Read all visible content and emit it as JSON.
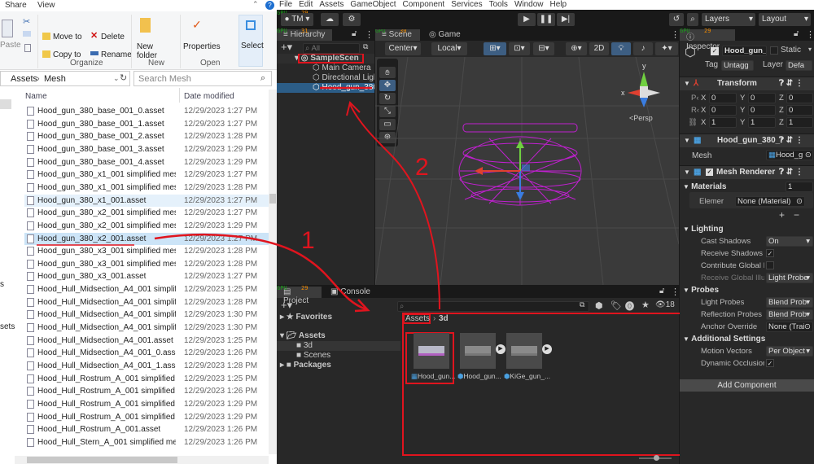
{
  "explorer": {
    "ribbon_tabs": [
      "Share",
      "View"
    ],
    "clipboard": {
      "paste": "Paste"
    },
    "organize": {
      "move_to": "Move to",
      "copy_to": "Copy to",
      "delete": "Delete",
      "rename": "Rename",
      "group": "Organize"
    },
    "new": {
      "new_folder": "New folder",
      "group": "New"
    },
    "open": {
      "properties": "Properties",
      "group": "Open"
    },
    "select": {
      "label": "Select"
    },
    "breadcrumb": [
      "Assets",
      "Mesh"
    ],
    "search_placeholder": "Search Mesh",
    "nav_labels": [
      "s",
      "sets"
    ],
    "columns": {
      "name": "Name",
      "date": "Date modified"
    },
    "files": [
      {
        "name": "Hood_gun_380_base_001_0.asset",
        "date": "12/29/2023 1:27 PM"
      },
      {
        "name": "Hood_gun_380_base_001_1.asset",
        "date": "12/29/2023 1:27 PM"
      },
      {
        "name": "Hood_gun_380_base_001_2.asset",
        "date": "12/29/2023 1:28 PM"
      },
      {
        "name": "Hood_gun_380_base_001_3.asset",
        "date": "12/29/2023 1:29 PM"
      },
      {
        "name": "Hood_gun_380_base_001_4.asset",
        "date": "12/29/2023 1:29 PM"
      },
      {
        "name": "Hood_gun_380_x1_001 simplified mesh.a...",
        "date": "12/29/2023 1:27 PM"
      },
      {
        "name": "Hood_gun_380_x1_001 simplified mesh_...",
        "date": "12/29/2023 1:28 PM"
      },
      {
        "name": "Hood_gun_380_x1_001.asset",
        "date": "12/29/2023 1:27 PM",
        "state": "hover"
      },
      {
        "name": "Hood_gun_380_x2_001 simplified mesh.a...",
        "date": "12/29/2023 1:27 PM"
      },
      {
        "name": "Hood_gun_380_x2_001 simplified mesh_...",
        "date": "12/29/2023 1:29 PM"
      },
      {
        "name": "Hood_gun_380_x2_001.asset",
        "date": "12/29/2023 1:27 PM",
        "state": "selected"
      },
      {
        "name": "Hood_gun_380_x3_001 simplified mesh.a...",
        "date": "12/29/2023 1:28 PM"
      },
      {
        "name": "Hood_gun_380_x3_001 simplified mesh_...",
        "date": "12/29/2023 1:28 PM"
      },
      {
        "name": "Hood_gun_380_x3_001.asset",
        "date": "12/29/2023 1:27 PM"
      },
      {
        "name": "Hood_Hull_Midsection_A4_001 simplified...",
        "date": "12/29/2023 1:25 PM"
      },
      {
        "name": "Hood_Hull_Midsection_A4_001 simplified...",
        "date": "12/29/2023 1:28 PM"
      },
      {
        "name": "Hood_Hull_Midsection_A4_001 simplified...",
        "date": "12/29/2023 1:30 PM"
      },
      {
        "name": "Hood_Hull_Midsection_A4_001 simplified...",
        "date": "12/29/2023 1:30 PM"
      },
      {
        "name": "Hood_Hull_Midsection_A4_001.asset",
        "date": "12/29/2023 1:25 PM"
      },
      {
        "name": "Hood_Hull_Midsection_A4_001_0.asset",
        "date": "12/29/2023 1:26 PM"
      },
      {
        "name": "Hood_Hull_Midsection_A4_001_1.asset",
        "date": "12/29/2023 1:28 PM"
      },
      {
        "name": "Hood_Hull_Rostrum_A_001 simplified me...",
        "date": "12/29/2023 1:25 PM"
      },
      {
        "name": "Hood_Hull_Rostrum_A_001 simplified me...",
        "date": "12/29/2023 1:26 PM"
      },
      {
        "name": "Hood_Hull_Rostrum_A_001 simplified me...",
        "date": "12/29/2023 1:29 PM"
      },
      {
        "name": "Hood_Hull_Rostrum_A_001 simplified me...",
        "date": "12/29/2023 1:29 PM"
      },
      {
        "name": "Hood_Hull_Rostrum_A_001.asset",
        "date": "12/29/2023 1:26 PM"
      },
      {
        "name": "Hood_Hull_Stern_A_001 simplified mesh....",
        "date": "12/29/2023 1:26 PM"
      }
    ]
  },
  "unity": {
    "menu": [
      "File",
      "Edit",
      "Assets",
      "GameObject",
      "Component",
      "Services",
      "Tools",
      "Window",
      "Help"
    ],
    "account": "TM",
    "layers": "Layers",
    "layout": "Layout",
    "overlay": {
      "gpu": "GPU",
      "temps": [
        "29",
        "31",
        "30",
        "29"
      ]
    },
    "hierarchy": {
      "title": "Hierarchy",
      "search_placeholder": "All",
      "scene": "SampleScen",
      "items": [
        "Main Camera",
        "Directional Ligl",
        "Hood_gun_380"
      ]
    },
    "scene": {
      "tabs": [
        "Scene",
        "Game"
      ],
      "pivot": "Center",
      "space": "Local",
      "mode_2d": "2D",
      "persp": "<Persp",
      "axis_x": "x",
      "axis_y": "y"
    },
    "project": {
      "tabs": [
        "Project",
        "Console"
      ],
      "tree": {
        "favorites": "Favorites",
        "assets": "Assets",
        "folders": [
          "3d",
          "Scenes"
        ],
        "packages": "Packages"
      },
      "breadcrumb": [
        "Assets",
        "3d"
      ],
      "hidden_count": "18",
      "items": [
        "Hood_gun...",
        "Hood_gun...",
        "KiGe_gun_..."
      ]
    },
    "inspector": {
      "title": "Inspector",
      "name": "Hood_gun_3",
      "static": "Static",
      "tag_label": "Tag",
      "tag": "Untagg",
      "layer_label": "Layer",
      "layer": "Defa",
      "transform": {
        "title": "Transform",
        "rows": [
          {
            "label": "P‹",
            "x": "0",
            "y": "0",
            "z": "0"
          },
          {
            "label": "R‹",
            "x": "0",
            "y": "0",
            "z": "0"
          },
          {
            "label": "",
            "x": "1",
            "y": "1",
            "z": "1"
          }
        ]
      },
      "mesh_filter": {
        "title": "Hood_gun_380_:",
        "mesh_label": "Mesh",
        "mesh": "Hood_g"
      },
      "mesh_renderer": {
        "title": "Mesh Renderer",
        "materials": "Materials",
        "materials_count": "1",
        "element": "Elemer",
        "element_value": "None (Material)",
        "lighting": "Lighting",
        "cast_shadows": "Cast Shadows",
        "cast_shadows_value": "On",
        "receive_shadows": "Receive Shadows",
        "contribute_gi": "Contribute Global Il",
        "receive_gi": "Receive Global Illu",
        "receive_gi_value": "Light Probe",
        "probes": "Probes",
        "light_probes": "Light Probes",
        "light_probes_value": "Blend Prob",
        "reflection_probes": "Reflection Probes",
        "reflection_probes_value": "Blend Prob",
        "anchor": "Anchor Override",
        "anchor_value": "None (Trai",
        "additional": "Additional Settings",
        "motion_vectors": "Motion Vectors",
        "motion_vectors_value": "Per Object",
        "dynamic_occlusion": "Dynamic Occlusion"
      },
      "add_component": "Add Component"
    }
  },
  "annotations": {
    "step1": "1",
    "step2": "2",
    "color": "#e0141e"
  }
}
